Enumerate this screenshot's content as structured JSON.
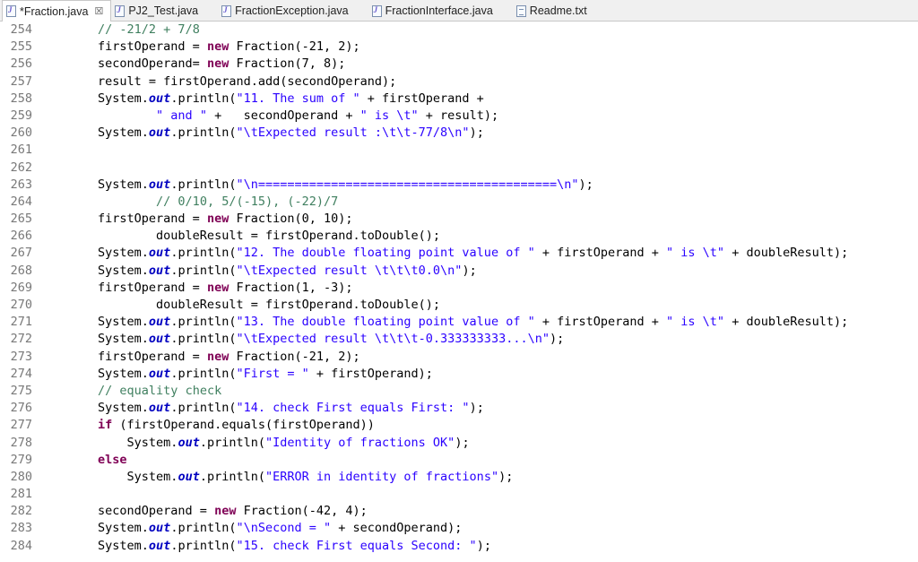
{
  "tabs": [
    {
      "label": "*Fraction.java",
      "icon": "java-file-icon",
      "active": true,
      "closable": true
    },
    {
      "label": "PJ2_Test.java",
      "icon": "java-file-icon"
    },
    {
      "label": "FractionException.java",
      "icon": "java-file-icon"
    },
    {
      "label": "FractionInterface.java",
      "icon": "java-file-icon"
    },
    {
      "label": "Readme.txt",
      "icon": "text-file-icon"
    }
  ],
  "close_glyph": "☒",
  "colors": {
    "keyword": "#7f0055",
    "string": "#2a00ff",
    "comment": "#3f7f5f",
    "field": "#0000c0",
    "line_number": "#787878"
  },
  "lines": [
    {
      "n": "254",
      "t": [
        [
          "        ",
          ""
        ],
        [
          "// -21/2 + 7/8",
          "cmt"
        ]
      ]
    },
    {
      "n": "255",
      "t": [
        [
          "        firstOperand = ",
          ""
        ],
        [
          "new",
          "kw"
        ],
        [
          " Fraction(-21, 2);",
          ""
        ]
      ]
    },
    {
      "n": "256",
      "t": [
        [
          "        secondOperand= ",
          ""
        ],
        [
          "new",
          "kw"
        ],
        [
          " Fraction(7, 8);",
          ""
        ]
      ]
    },
    {
      "n": "257",
      "t": [
        [
          "        result = firstOperand.add(secondOperand);",
          ""
        ]
      ]
    },
    {
      "n": "258",
      "t": [
        [
          "        System.",
          ""
        ],
        [
          "out",
          "fld"
        ],
        [
          ".println(",
          ""
        ],
        [
          "\"11. The sum of \"",
          "str"
        ],
        [
          " + firstOperand +",
          ""
        ]
      ]
    },
    {
      "n": "259",
      "t": [
        [
          "                ",
          ""
        ],
        [
          "\" and \"",
          "str"
        ],
        [
          " +   secondOperand + ",
          ""
        ],
        [
          "\" is \\t\"",
          "str"
        ],
        [
          " + result);",
          ""
        ]
      ]
    },
    {
      "n": "260",
      "t": [
        [
          "        System.",
          ""
        ],
        [
          "out",
          "fld"
        ],
        [
          ".println(",
          ""
        ],
        [
          "\"\\tExpected result :\\t\\t-77/8\\n\"",
          "str"
        ],
        [
          ");",
          ""
        ]
      ]
    },
    {
      "n": "261",
      "t": []
    },
    {
      "n": "262",
      "t": []
    },
    {
      "n": "263",
      "t": [
        [
          "        System.",
          ""
        ],
        [
          "out",
          "fld"
        ],
        [
          ".println(",
          ""
        ],
        [
          "\"\\n=========================================\\n\"",
          "str"
        ],
        [
          ");",
          ""
        ]
      ]
    },
    {
      "n": "264",
      "t": [
        [
          "                ",
          ""
        ],
        [
          "// 0/10, 5/(-15), (-22)/7",
          "cmt"
        ]
      ]
    },
    {
      "n": "265",
      "t": [
        [
          "        firstOperand = ",
          ""
        ],
        [
          "new",
          "kw"
        ],
        [
          " Fraction(0, 10);",
          ""
        ]
      ]
    },
    {
      "n": "266",
      "t": [
        [
          "                doubleResult = firstOperand.toDouble();",
          ""
        ]
      ]
    },
    {
      "n": "267",
      "t": [
        [
          "        System.",
          ""
        ],
        [
          "out",
          "fld"
        ],
        [
          ".println(",
          ""
        ],
        [
          "\"12. The double floating point value of \"",
          "str"
        ],
        [
          " + firstOperand + ",
          ""
        ],
        [
          "\" is \\t\"",
          "str"
        ],
        [
          " + doubleResult);",
          ""
        ]
      ]
    },
    {
      "n": "268",
      "t": [
        [
          "        System.",
          ""
        ],
        [
          "out",
          "fld"
        ],
        [
          ".println(",
          ""
        ],
        [
          "\"\\tExpected result \\t\\t\\t0.0\\n\"",
          "str"
        ],
        [
          ");",
          ""
        ]
      ]
    },
    {
      "n": "269",
      "t": [
        [
          "        firstOperand = ",
          ""
        ],
        [
          "new",
          "kw"
        ],
        [
          " Fraction(1, -3);",
          ""
        ]
      ]
    },
    {
      "n": "270",
      "t": [
        [
          "                doubleResult = firstOperand.toDouble();",
          ""
        ]
      ]
    },
    {
      "n": "271",
      "t": [
        [
          "        System.",
          ""
        ],
        [
          "out",
          "fld"
        ],
        [
          ".println(",
          ""
        ],
        [
          "\"13. The double floating point value of \"",
          "str"
        ],
        [
          " + firstOperand + ",
          ""
        ],
        [
          "\" is \\t\"",
          "str"
        ],
        [
          " + doubleResult);",
          ""
        ]
      ]
    },
    {
      "n": "272",
      "t": [
        [
          "        System.",
          ""
        ],
        [
          "out",
          "fld"
        ],
        [
          ".println(",
          ""
        ],
        [
          "\"\\tExpected result \\t\\t\\t-0.333333333...\\n\"",
          "str"
        ],
        [
          ");",
          ""
        ]
      ]
    },
    {
      "n": "273",
      "t": [
        [
          "        firstOperand = ",
          ""
        ],
        [
          "new",
          "kw"
        ],
        [
          " Fraction(-21, 2);",
          ""
        ]
      ]
    },
    {
      "n": "274",
      "t": [
        [
          "        System.",
          ""
        ],
        [
          "out",
          "fld"
        ],
        [
          ".println(",
          ""
        ],
        [
          "\"First = \"",
          "str"
        ],
        [
          " + firstOperand);",
          ""
        ]
      ]
    },
    {
      "n": "275",
      "t": [
        [
          "        ",
          ""
        ],
        [
          "// equality check",
          "cmt"
        ]
      ]
    },
    {
      "n": "276",
      "t": [
        [
          "        System.",
          ""
        ],
        [
          "out",
          "fld"
        ],
        [
          ".println(",
          ""
        ],
        [
          "\"14. check First equals First: \"",
          "str"
        ],
        [
          ");",
          ""
        ]
      ]
    },
    {
      "n": "277",
      "t": [
        [
          "        ",
          ""
        ],
        [
          "if",
          "kw"
        ],
        [
          " (firstOperand.equals(firstOperand))",
          ""
        ]
      ]
    },
    {
      "n": "278",
      "t": [
        [
          "            System.",
          ""
        ],
        [
          "out",
          "fld"
        ],
        [
          ".println(",
          ""
        ],
        [
          "\"Identity of fractions OK\"",
          "str"
        ],
        [
          ");",
          ""
        ]
      ]
    },
    {
      "n": "279",
      "t": [
        [
          "        ",
          ""
        ],
        [
          "else",
          "kw"
        ]
      ]
    },
    {
      "n": "280",
      "t": [
        [
          "            System.",
          ""
        ],
        [
          "out",
          "fld"
        ],
        [
          ".println(",
          ""
        ],
        [
          "\"ERROR in identity of fractions\"",
          "str"
        ],
        [
          ");",
          ""
        ]
      ]
    },
    {
      "n": "281",
      "t": []
    },
    {
      "n": "282",
      "t": [
        [
          "        secondOperand = ",
          ""
        ],
        [
          "new",
          "kw"
        ],
        [
          " Fraction(-42, 4);",
          ""
        ]
      ]
    },
    {
      "n": "283",
      "t": [
        [
          "        System.",
          ""
        ],
        [
          "out",
          "fld"
        ],
        [
          ".println(",
          ""
        ],
        [
          "\"\\nSecond = \"",
          "str"
        ],
        [
          " + secondOperand);",
          ""
        ]
      ]
    },
    {
      "n": "284",
      "t": [
        [
          "        System.",
          ""
        ],
        [
          "out",
          "fld"
        ],
        [
          ".println(",
          ""
        ],
        [
          "\"15. check First equals Second: \"",
          "str"
        ],
        [
          ");",
          ""
        ]
      ]
    }
  ]
}
